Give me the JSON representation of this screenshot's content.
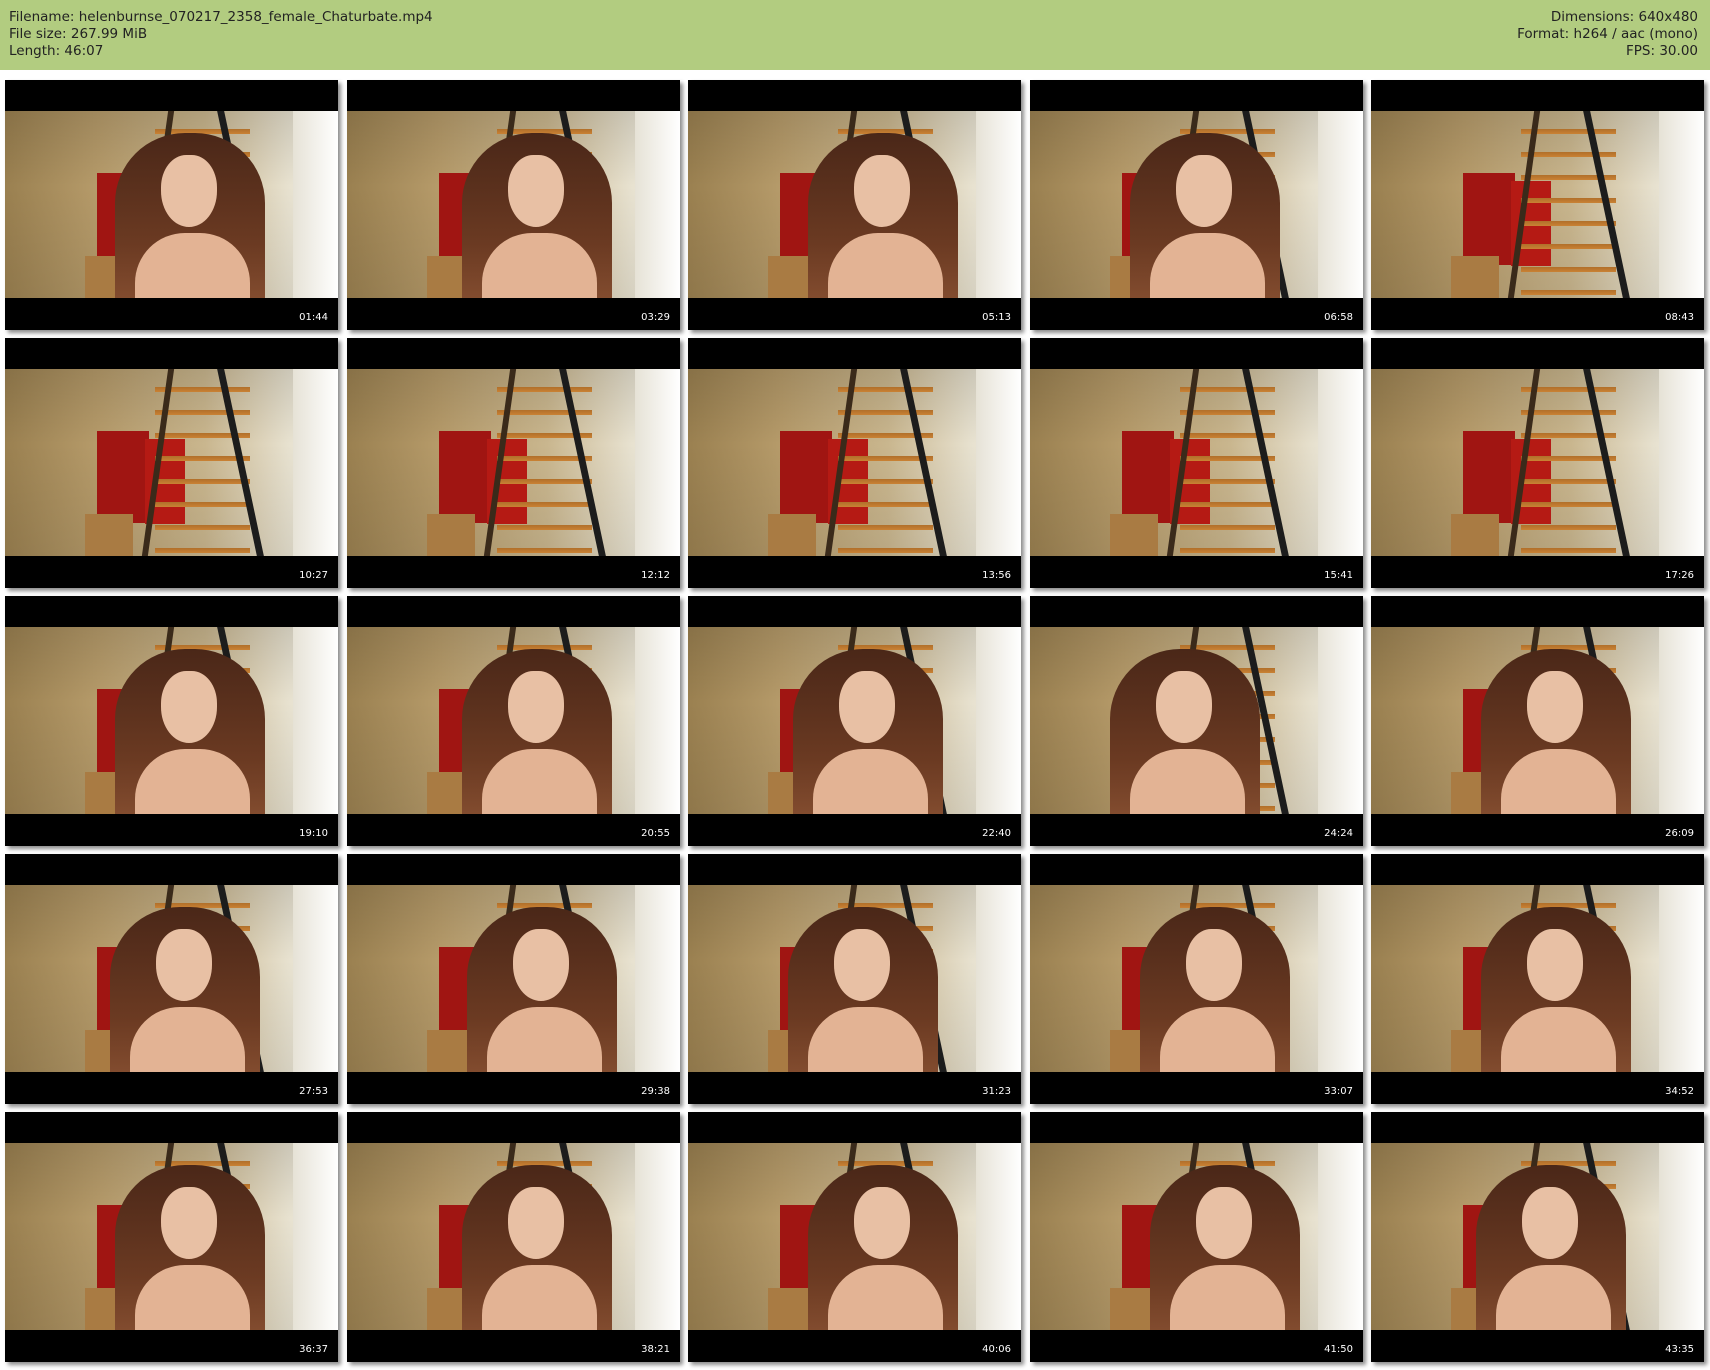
{
  "header": {
    "filename": "Filename: helenburnse_070217_2358_female_Chaturbate.mp4",
    "filesize": "File size: 267.99 MiB",
    "length": "Length: 46:07",
    "dimensions": "Dimensions: 640x480",
    "format": "Format: h264 / aac (mono)",
    "fps": "FPS: 30.00"
  },
  "thumbnails": [
    {
      "timestamp": "01:44",
      "person": true
    },
    {
      "timestamp": "03:29",
      "person": true
    },
    {
      "timestamp": "05:13",
      "person": true
    },
    {
      "timestamp": "06:58",
      "person": true
    },
    {
      "timestamp": "08:43",
      "person": false
    },
    {
      "timestamp": "10:27",
      "person": false
    },
    {
      "timestamp": "12:12",
      "person": false
    },
    {
      "timestamp": "13:56",
      "person": false
    },
    {
      "timestamp": "15:41",
      "person": false
    },
    {
      "timestamp": "17:26",
      "person": false
    },
    {
      "timestamp": "19:10",
      "person": true
    },
    {
      "timestamp": "20:55",
      "person": true
    },
    {
      "timestamp": "22:40",
      "person": true
    },
    {
      "timestamp": "24:24",
      "person": true
    },
    {
      "timestamp": "26:09",
      "person": true
    },
    {
      "timestamp": "27:53",
      "person": true
    },
    {
      "timestamp": "29:38",
      "person": true
    },
    {
      "timestamp": "31:23",
      "person": true
    },
    {
      "timestamp": "33:07",
      "person": true
    },
    {
      "timestamp": "34:52",
      "person": true
    },
    {
      "timestamp": "36:37",
      "person": true
    },
    {
      "timestamp": "38:21",
      "person": true
    },
    {
      "timestamp": "40:06",
      "person": true
    },
    {
      "timestamp": "41:50",
      "person": true
    },
    {
      "timestamp": "43:35",
      "person": true
    }
  ]
}
